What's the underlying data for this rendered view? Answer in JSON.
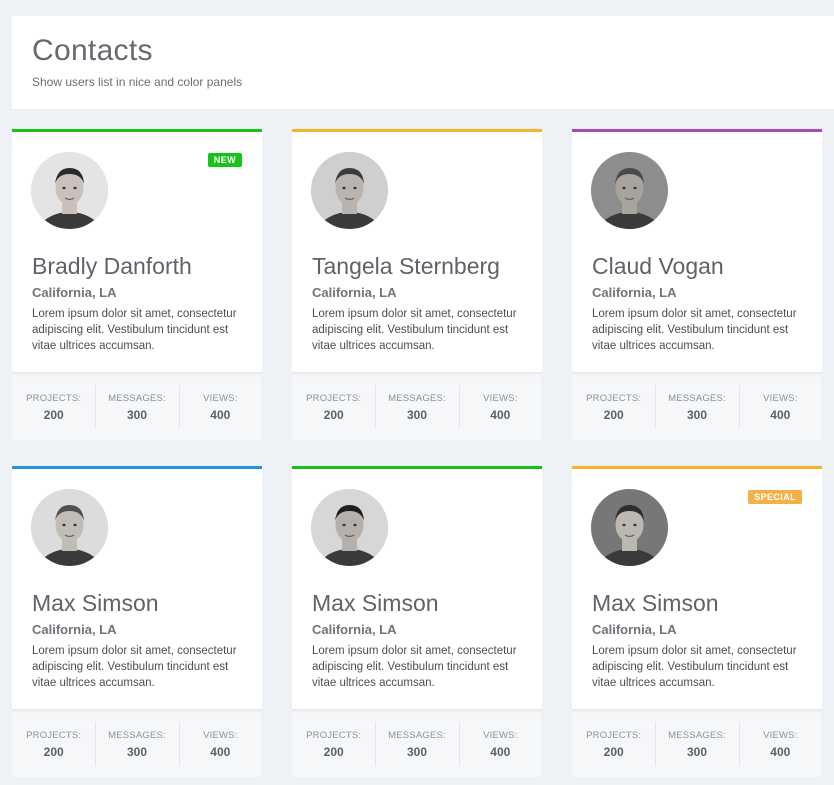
{
  "header": {
    "title": "Contacts",
    "subtitle": "Show users list in nice and color panels"
  },
  "colors": {
    "green": "#19c21b",
    "yellow": "#f3b52a",
    "purple": "#a64bb7",
    "blue": "#2595d8",
    "badge_new": "#17c21a",
    "badge_special": "#f3b147"
  },
  "stat_labels": {
    "projects": "PROJECTS:",
    "messages": "MESSAGES:",
    "views": "VIEWS:"
  },
  "contacts": [
    {
      "name": "Bradly Danforth",
      "location": "California, LA",
      "description": "Lorem ipsum dolor sit amet, consectetur adipiscing elit. Vestibulum tincidunt est vitae ultrices accumsan.",
      "accent": "green",
      "badge": "NEW",
      "badge_color": "badge_new",
      "avatar_icon": "user-photo-avatar",
      "projects": "200",
      "messages": "300",
      "views": "400"
    },
    {
      "name": "Tangela Sternberg",
      "location": "California, LA",
      "description": "Lorem ipsum dolor sit amet, consectetur adipiscing elit. Vestibulum tincidunt est vitae ultrices accumsan.",
      "accent": "yellow",
      "badge": "",
      "avatar_icon": "user-photo-avatar",
      "projects": "200",
      "messages": "300",
      "views": "400"
    },
    {
      "name": "Claud Vogan",
      "location": "California, LA",
      "description": "Lorem ipsum dolor sit amet, consectetur adipiscing elit. Vestibulum tincidunt est vitae ultrices accumsan.",
      "accent": "purple",
      "badge": "",
      "avatar_icon": "user-photo-avatar",
      "projects": "200",
      "messages": "300",
      "views": "400"
    },
    {
      "name": "Max Simson",
      "location": "California, LA",
      "description": "Lorem ipsum dolor sit amet, consectetur adipiscing elit. Vestibulum tincidunt est vitae ultrices accumsan.",
      "accent": "blue",
      "badge": "",
      "avatar_icon": "user-photo-avatar",
      "projects": "200",
      "messages": "300",
      "views": "400"
    },
    {
      "name": "Max Simson",
      "location": "California, LA",
      "description": "Lorem ipsum dolor sit amet, consectetur adipiscing elit. Vestibulum tincidunt est vitae ultrices accumsan.",
      "accent": "green",
      "badge": "",
      "avatar_icon": "user-photo-avatar",
      "projects": "200",
      "messages": "300",
      "views": "400"
    },
    {
      "name": "Max Simson",
      "location": "California, LA",
      "description": "Lorem ipsum dolor sit amet, consectetur adipiscing elit. Vestibulum tincidunt est vitae ultrices accumsan.",
      "accent": "yellow",
      "badge": "SPECIAL",
      "badge_color": "badge_special",
      "avatar_icon": "user-photo-avatar",
      "projects": "200",
      "messages": "300",
      "views": "400"
    }
  ]
}
